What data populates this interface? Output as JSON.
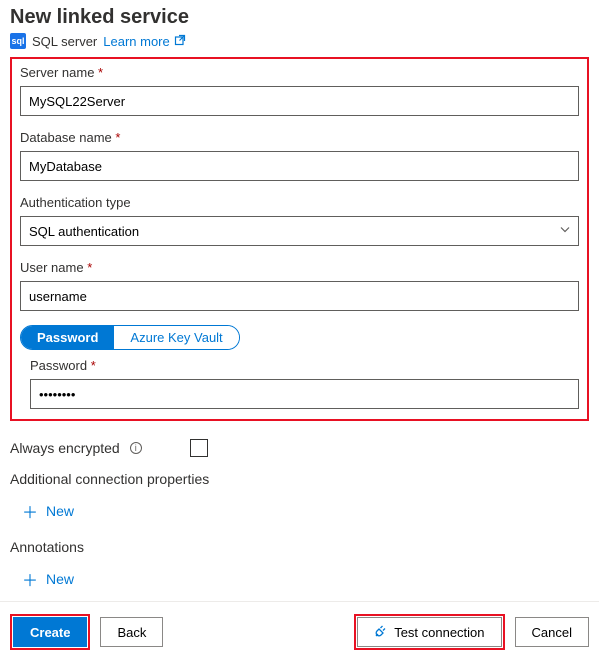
{
  "header": {
    "title": "New linked service",
    "service_type": "SQL server",
    "learn_more": "Learn more"
  },
  "form": {
    "server_name": {
      "label": "Server name",
      "value": "MySQL22Server"
    },
    "database_name": {
      "label": "Database name",
      "value": "MyDatabase"
    },
    "auth_type": {
      "label": "Authentication type",
      "value": "SQL authentication"
    },
    "user_name": {
      "label": "User name",
      "value": "username"
    },
    "password_tabs": {
      "password": "Password",
      "akv": "Azure Key Vault"
    },
    "password": {
      "label": "Password",
      "value": "••••••••"
    }
  },
  "always_encrypted_label": "Always encrypted",
  "additional_props_label": "Additional connection properties",
  "annotations_label": "Annotations",
  "new_label": "New",
  "footer": {
    "create": "Create",
    "back": "Back",
    "test_connection": "Test connection",
    "cancel": "Cancel"
  }
}
